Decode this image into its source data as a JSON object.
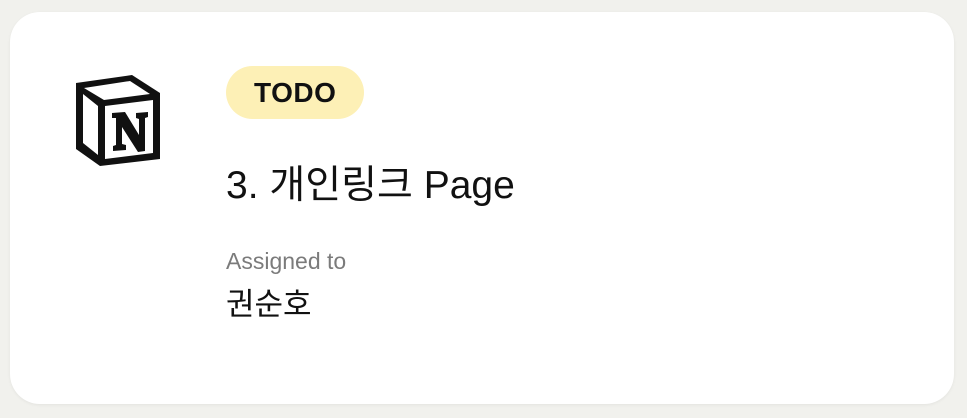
{
  "card": {
    "logo_icon": "notion-logo-icon",
    "status_badge": "TODO",
    "status_color": "#fdf0b6",
    "title": "3. 개인링크 Page",
    "assigned_label": "Assigned to",
    "assignee": "권순호"
  }
}
